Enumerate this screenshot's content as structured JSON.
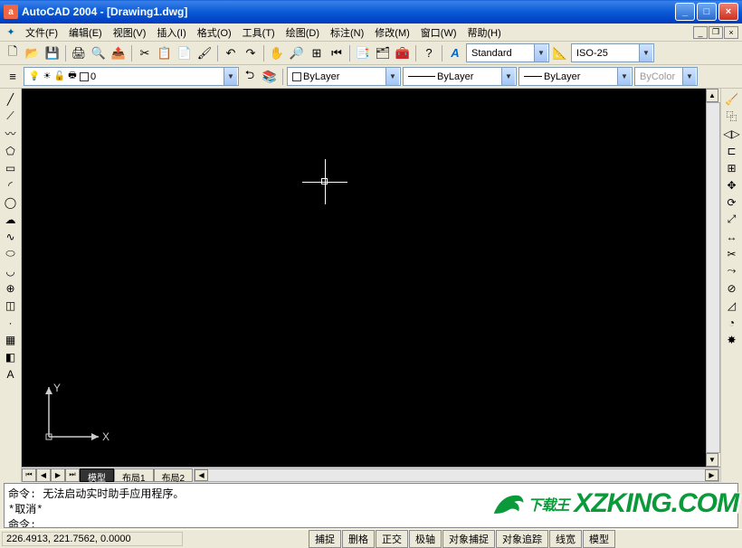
{
  "window": {
    "title": "AutoCAD 2004 - [Drawing1.dwg]",
    "minimize": "_",
    "maximize": "□",
    "close": "×"
  },
  "menu": {
    "file": "文件(F)",
    "edit": "编辑(E)",
    "view": "视图(V)",
    "insert": "插入(I)",
    "format": "格式(O)",
    "tools": "工具(T)",
    "draw": "绘图(D)",
    "dimension": "标注(N)",
    "modify": "修改(M)",
    "window": "窗口(W)",
    "help": "帮助(H)"
  },
  "style_tb": {
    "text_style": "Standard",
    "dim_style": "ISO-25"
  },
  "layer_tb": {
    "current_layer": "0",
    "linetype": "ByLayer",
    "lineweight": "ByLayer",
    "plotstyle": "ByLayer",
    "bycolor": "ByColor"
  },
  "tabs": {
    "model": "模型",
    "layout1": "布局1",
    "layout2": "布局2"
  },
  "command": {
    "line1": "命令: 无法启动实时助手应用程序。",
    "line2": "*取消*",
    "prompt": "命令:"
  },
  "status": {
    "coords": "226.4913, 221.7562, 0.0000",
    "snap": "捕捉",
    "grid": "删格",
    "ortho": "正交",
    "polar": "极轴",
    "osnap": "对象捕捉",
    "otrack": "对象追踪",
    "lwt": "线宽",
    "model": "模型"
  },
  "ucs": {
    "x": "X",
    "y": "Y"
  },
  "watermark": {
    "cn": "下载王",
    "url": "XZKING.COM"
  }
}
